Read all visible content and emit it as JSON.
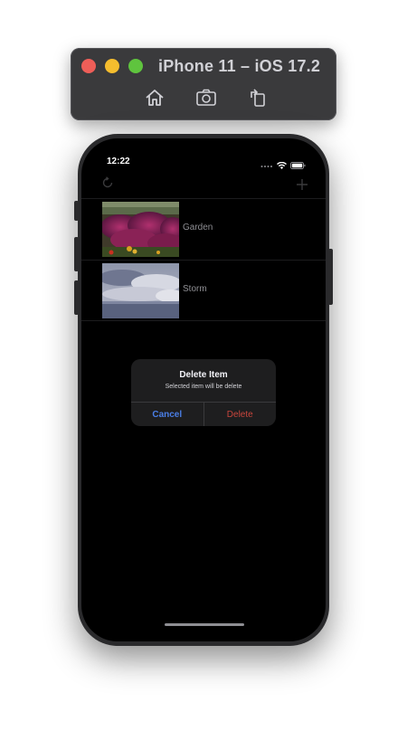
{
  "simulator": {
    "title": "iPhone 11 – iOS 17.2",
    "toolbar": [
      "home-icon",
      "screenshot-icon",
      "rotate-icon"
    ]
  },
  "status_bar": {
    "time": "12:22"
  },
  "nav": {
    "left_icon": "refresh-icon",
    "right_icon": "plus-icon"
  },
  "list": {
    "items": [
      {
        "label": "Garden",
        "thumbnail": "garden-photo"
      },
      {
        "label": "Storm",
        "thumbnail": "storm-photo"
      }
    ]
  },
  "alert": {
    "title": "Delete Item",
    "message": "Selected item will be delete",
    "cancel_label": "Cancel",
    "delete_label": "Delete"
  },
  "colors": {
    "cancel": "#4a7ee6",
    "delete": "#c8453c",
    "screen_bg": "#000000"
  }
}
